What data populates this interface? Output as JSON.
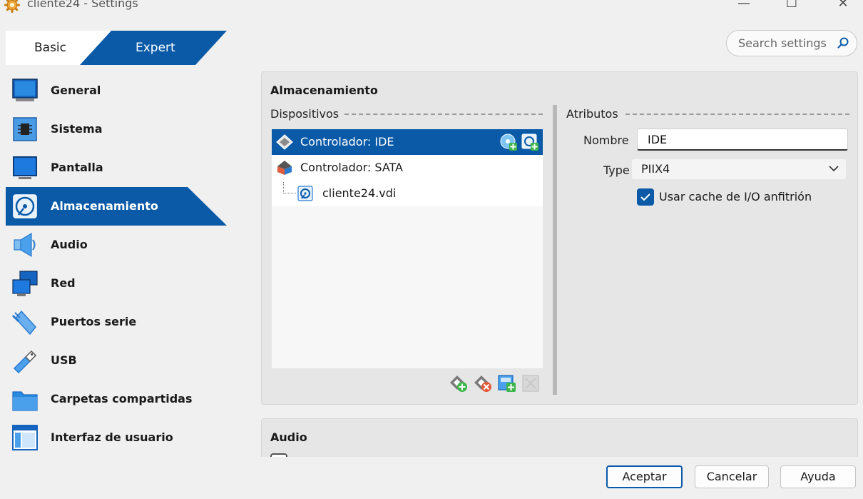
{
  "window": {
    "title": "cliente24 - Settings",
    "minimize_glyph": "—",
    "maximize_glyph": "☐",
    "close_glyph": "✕"
  },
  "mode_tabs": {
    "basic": "Basic",
    "expert": "Expert",
    "active": "Expert"
  },
  "search": {
    "placeholder": "Search settings",
    "value": ""
  },
  "sidebar": {
    "active": "Almacenamiento",
    "items": [
      {
        "label": "General",
        "icon": "monitor-icon"
      },
      {
        "label": "Sistema",
        "icon": "chip-icon"
      },
      {
        "label": "Pantalla",
        "icon": "display-icon"
      },
      {
        "label": "Almacenamiento",
        "icon": "storage-disk-icon"
      },
      {
        "label": "Audio",
        "icon": "speaker-icon"
      },
      {
        "label": "Red",
        "icon": "network-icon"
      },
      {
        "label": "Puertos serie",
        "icon": "serial-port-icon"
      },
      {
        "label": "USB",
        "icon": "usb-icon"
      },
      {
        "label": "Carpetas compartidas",
        "icon": "folder-icon"
      },
      {
        "label": "Interfaz de usuario",
        "icon": "window-layout-icon"
      }
    ]
  },
  "storage": {
    "title": "Almacenamiento",
    "devices_label": "Dispositivos",
    "attributes_label": "Atributos",
    "tree": [
      {
        "label": "Controlador: IDE",
        "icon": "ide-controller-icon",
        "selected": true
      },
      {
        "label": "Controlador: SATA",
        "icon": "sata-controller-icon",
        "selected": false
      },
      {
        "label": "cliente24.vdi",
        "icon": "hard-disk-icon",
        "selected": false
      }
    ],
    "attributes": {
      "name_label": "Nombre",
      "name_value": "IDE",
      "type_label": "Type",
      "type_value": "PIIX4",
      "cache_label": "Usar cache de I/O anfitrión",
      "cache_checked": true
    }
  },
  "audio_section": {
    "title": "Audio"
  },
  "footer": {
    "ok": "Aceptar",
    "cancel": "Cancelar",
    "help": "Ayuda"
  },
  "colors": {
    "accent": "#0a5aa8",
    "background": "#f0f0f0",
    "panel": "#e6e6e6",
    "add_green": "#3cb64a",
    "remove_red": "#e05a3c"
  }
}
